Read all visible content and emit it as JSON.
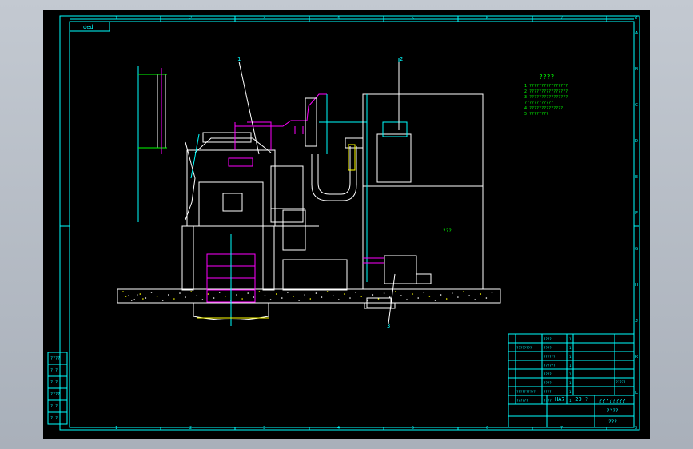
{
  "border": {
    "top_numbers": [
      "1",
      "2",
      "3",
      "4",
      "5",
      "6",
      "7",
      "8"
    ],
    "bottom_numbers": [
      "1",
      "2",
      "3",
      "4",
      "5",
      "6",
      "7",
      "8"
    ],
    "right_letters": [
      "A",
      "B",
      "C",
      "D",
      "E",
      "F",
      "G",
      "H",
      "J",
      "K",
      "L"
    ],
    "corner_tag": "ded"
  },
  "callouts": [
    "1",
    "2",
    "3"
  ],
  "notes": {
    "title": "????",
    "lines": [
      "1.????????????????",
      "2.????????????????",
      "3.????????????????",
      "  ????????????",
      "4.??????????????",
      "5.????????"
    ]
  },
  "labels": {
    "right_room": "???"
  },
  "parts_list": [
    {
      "no": "",
      "name": "",
      "code": "????",
      "qty": "1"
    },
    {
      "no": "",
      "name": "????????",
      "code": "????",
      "qty": "1"
    },
    {
      "no": "",
      "name": "",
      "code": "??????",
      "qty": "1"
    },
    {
      "no": "",
      "name": "",
      "code": "??????",
      "qty": "1"
    },
    {
      "no": "",
      "name": "",
      "code": "????",
      "qty": "1"
    },
    {
      "no": "",
      "name": "",
      "code": "????",
      "qty": "1"
    },
    {
      "no": "",
      "name": "????????/?",
      "code": "????",
      "qty": "1"
    },
    {
      "no": "",
      "name": "??????",
      "code": "????",
      "qty": "1"
    }
  ],
  "title_block": {
    "project": "????????",
    "drawing": "????",
    "sheet": "???",
    "code": "HA7 - 20 ?",
    "stamp": "??????"
  },
  "revision_block": [
    "????",
    "? ?",
    "? ?",
    "????",
    "? ?",
    "? ?"
  ]
}
